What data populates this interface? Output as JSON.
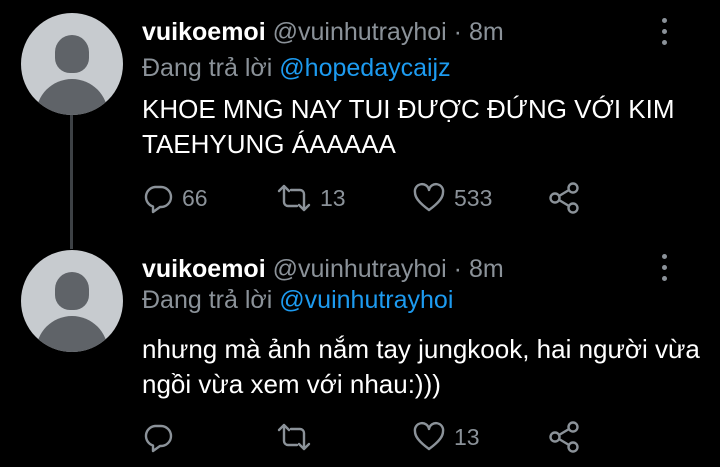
{
  "tweets": [
    {
      "author": "vuikoemoi",
      "handle": "@vuinhutrayhoi",
      "dot": "·",
      "time": "8m",
      "reply_prefix": "Đang trả lời",
      "reply_to": "@hopedaycaijz",
      "text": "KHOE MNG NAY TUI ĐƯỢC ĐỨNG VỚI KIM TAEHYUNG ÁAAAAA",
      "replies": "66",
      "retweets": "13",
      "likes": "533"
    },
    {
      "author": "vuikoemoi",
      "handle": "@vuinhutrayhoi",
      "dot": "·",
      "time": "8m",
      "reply_prefix": "Đang trả lời",
      "reply_to": "@vuinhutrayhoi",
      "text": "nhưng mà ảnh nắm tay jungkook, hai người vừa ngồi vừa xem với nhau:)))",
      "replies": "",
      "retweets": "",
      "likes": "13"
    }
  ],
  "icons": {
    "reply": "reply-icon",
    "retweet": "retweet-icon",
    "like": "heart-icon",
    "share": "share-icon",
    "more": "more-vertical-icon"
  },
  "colors": {
    "background": "#000000",
    "text": "#ffffff",
    "secondary": "#8b9299",
    "link": "#1d9bf0"
  }
}
